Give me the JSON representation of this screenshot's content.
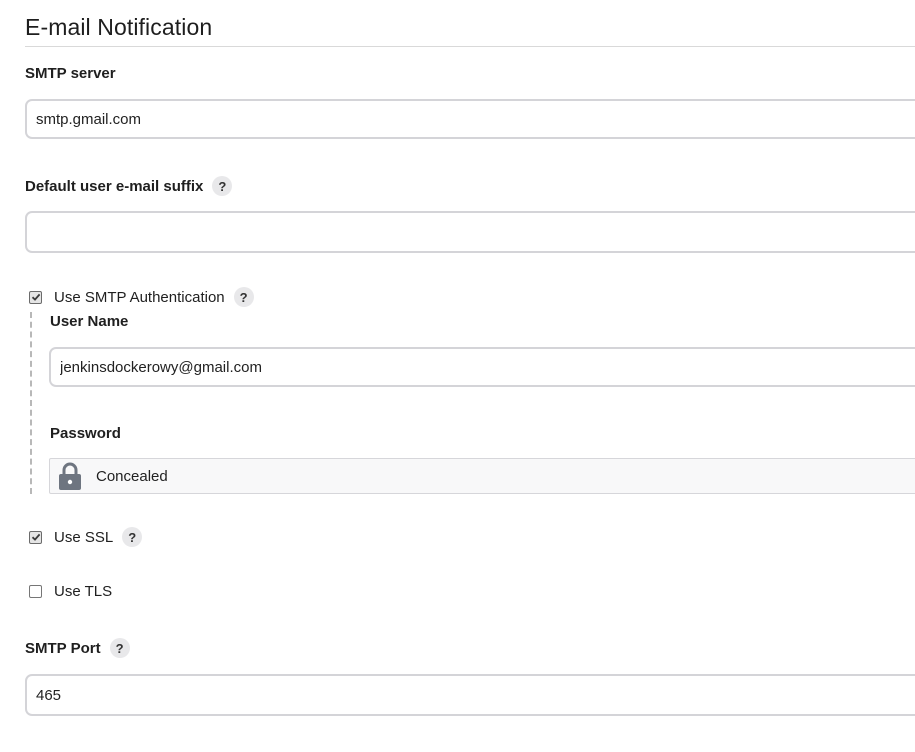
{
  "section": {
    "title": "E-mail Notification"
  },
  "smtp_server": {
    "label": "SMTP server",
    "value": "smtp.gmail.com"
  },
  "email_suffix": {
    "label": "Default user e-mail suffix",
    "value": "",
    "help": "?"
  },
  "smtp_auth": {
    "label": "Use SMTP Authentication",
    "checked": true,
    "help": "?",
    "username": {
      "label": "User Name",
      "value": "jenkinsdockerowy@gmail.com"
    },
    "password": {
      "label": "Password",
      "value": "Concealed",
      "icon": "lock-icon"
    }
  },
  "use_ssl": {
    "label": "Use SSL",
    "checked": true,
    "help": "?"
  },
  "use_tls": {
    "label": "Use TLS",
    "checked": false
  },
  "smtp_port": {
    "label": "SMTP Port",
    "value": "465",
    "help": "?"
  },
  "colors": {
    "help_bg": "#e8e8ea",
    "input_border": "#d4d4d8",
    "concealed_bg": "#f8f8f9",
    "lock": "#6e7580"
  }
}
